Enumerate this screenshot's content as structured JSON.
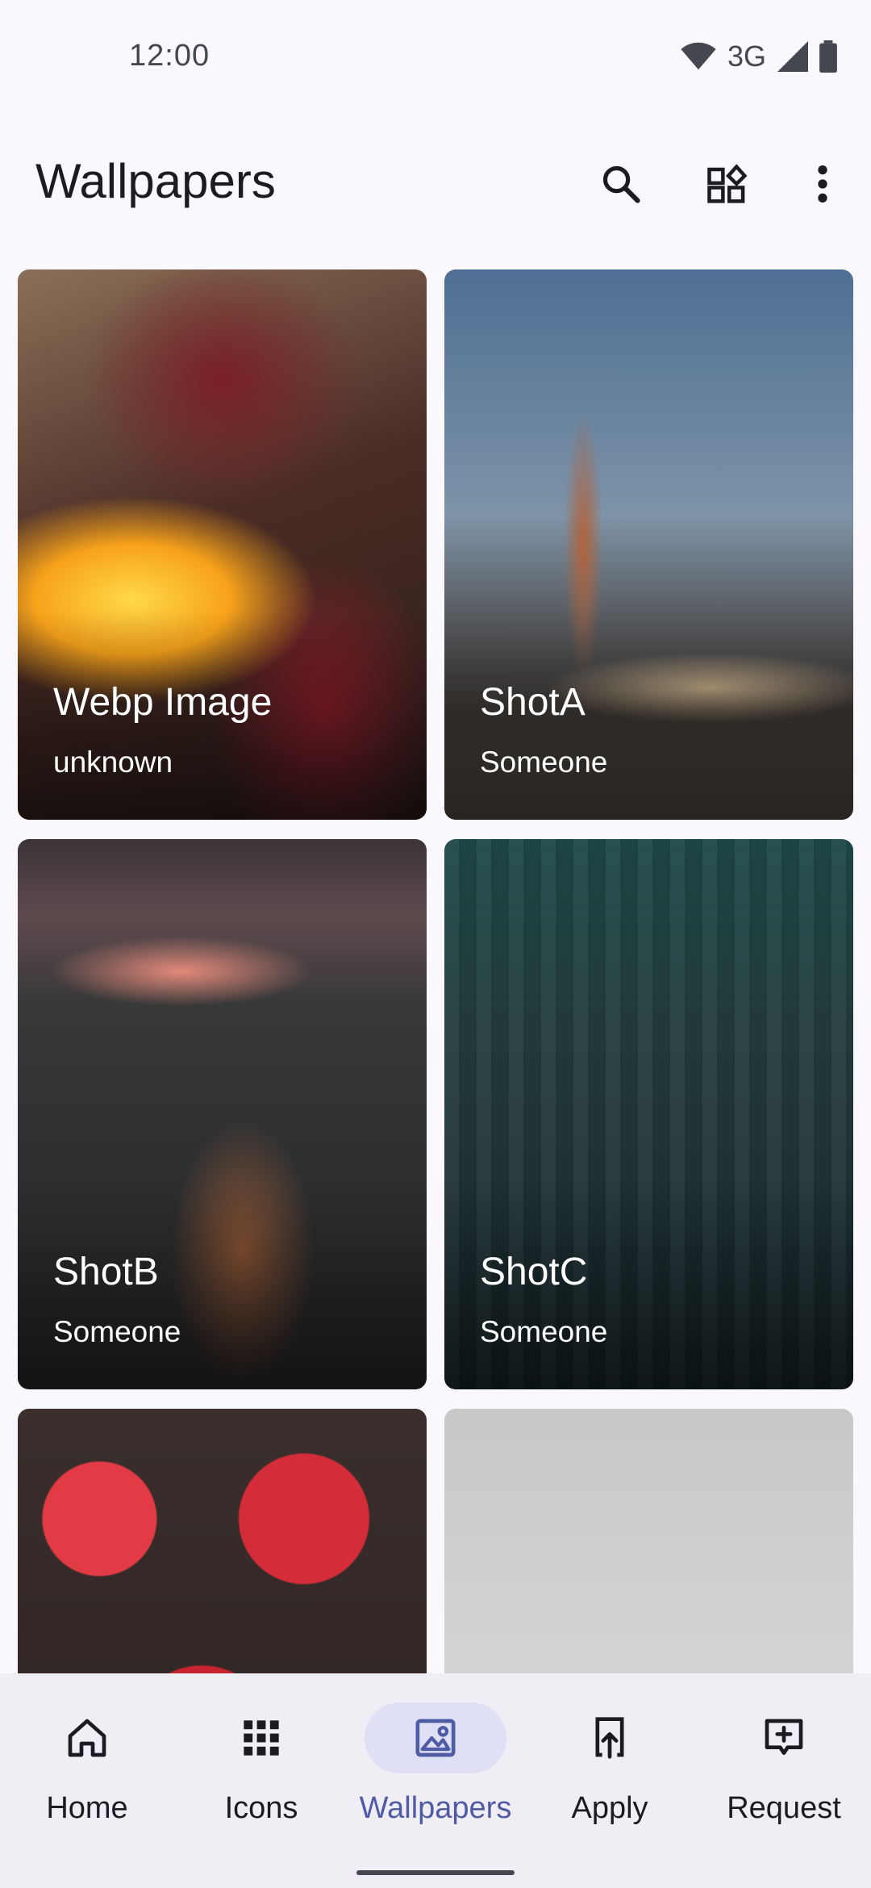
{
  "status": {
    "time": "12:00",
    "network": "3G"
  },
  "appbar": {
    "title": "Wallpapers"
  },
  "wallpapers": [
    {
      "title": "Webp Image",
      "author": "unknown"
    },
    {
      "title": "ShotA",
      "author": "Someone"
    },
    {
      "title": "ShotB",
      "author": "Someone"
    },
    {
      "title": "ShotC",
      "author": "Someone"
    },
    {
      "title": "",
      "author": ""
    },
    {
      "title": "",
      "author": ""
    }
  ],
  "nav": {
    "items": [
      {
        "label": "Home",
        "icon": "home-icon"
      },
      {
        "label": "Icons",
        "icon": "apps-grid-icon"
      },
      {
        "label": "Wallpapers",
        "icon": "image-icon",
        "active": true
      },
      {
        "label": "Apply",
        "icon": "apply-icon"
      },
      {
        "label": "Request",
        "icon": "request-icon"
      }
    ]
  },
  "colors": {
    "accent": "#4f5ba2",
    "nav_active_bg": "#dfe0f5",
    "background": "#fbf8fd"
  }
}
